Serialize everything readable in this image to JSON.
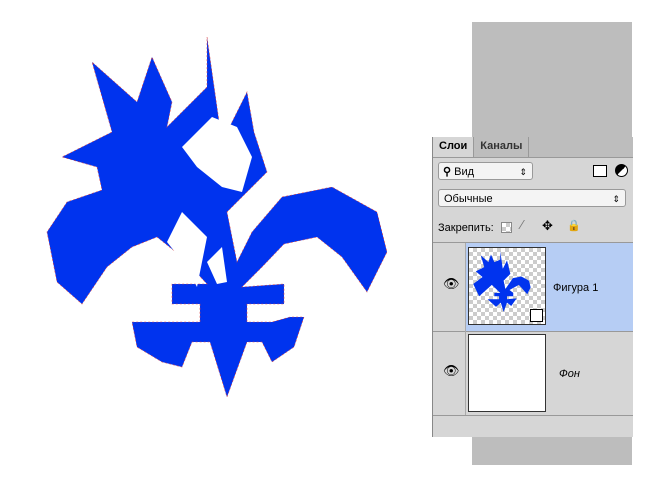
{
  "panel": {
    "tabs": [
      {
        "label": "Слои",
        "active": true
      },
      {
        "label": "Каналы",
        "active": false
      }
    ],
    "filter": {
      "label": "Вид",
      "icon": "search-icon"
    },
    "blend_mode": "Обычные",
    "lock_label": "Закрепить:",
    "layers": [
      {
        "name": "Фигура 1",
        "selected": true,
        "visible": true
      },
      {
        "name": "Фон",
        "selected": false,
        "visible": true
      }
    ]
  },
  "colors": {
    "shape": "#0033ee",
    "selected_layer": "#b6cdf4"
  }
}
